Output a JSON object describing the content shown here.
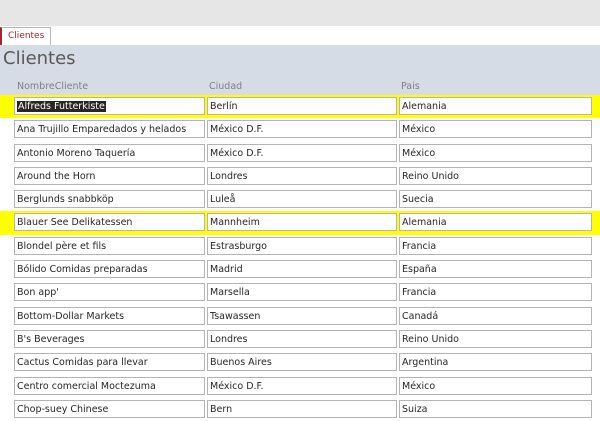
{
  "tab": {
    "label": "Clientes"
  },
  "form": {
    "title": "Clientes",
    "columns": [
      "NombreCliente",
      "Ciudad",
      "Pais"
    ]
  },
  "rows": [
    [
      "Alfreds Futterkiste",
      "Berlín",
      "Alemania"
    ],
    [
      "Ana Trujillo Emparedados y helados",
      "México D.F.",
      "México"
    ],
    [
      "Antonio Moreno Taquería",
      "México D.F.",
      "México"
    ],
    [
      "Around the Horn",
      "Londres",
      "Reino Unido"
    ],
    [
      "Berglunds snabbköp",
      "Luleå",
      "Suecia"
    ],
    [
      "Blauer See Delikatessen",
      "Mannheim",
      "Alemania"
    ],
    [
      "Blondel père et fils",
      "Estrasburgo",
      "Francia"
    ],
    [
      "Bólido Comidas preparadas",
      "Madrid",
      "España"
    ],
    [
      "Bon app'",
      "Marsella",
      "Francia"
    ],
    [
      "Bottom-Dollar Markets",
      "Tsawassen",
      "Canadá"
    ],
    [
      "B's Beverages",
      "Londres",
      "Reino Unido"
    ],
    [
      "Cactus Comidas para llevar",
      "Buenos Aires",
      "Argentina"
    ],
    [
      "Centro comercial Moctezuma",
      "México D.F.",
      "México"
    ],
    [
      "Chop-suey Chinese",
      "Bern",
      "Suiza"
    ]
  ],
  "highlighted_rows": [
    0,
    5
  ],
  "colors": {
    "highlight": "#ffff00",
    "header": "#d6dce5",
    "tab": "#a4262c"
  }
}
